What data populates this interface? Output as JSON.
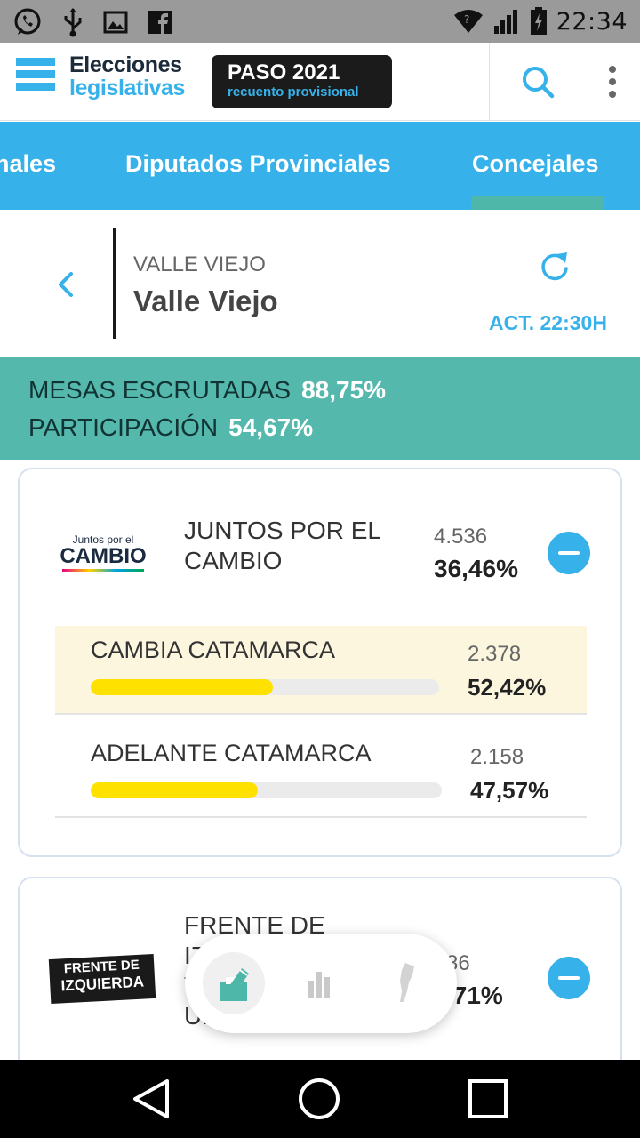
{
  "status_bar": {
    "time": "22:34",
    "icons_left": [
      "whatsapp-icon",
      "usb-icon",
      "image-icon",
      "facebook-icon"
    ],
    "icons_right": [
      "wifi-icon",
      "signal-icon",
      "battery-icon"
    ]
  },
  "header": {
    "logo_line1": "Elecciones",
    "logo_line2": "legislativas",
    "badge_title": "PASO 2021",
    "badge_subtitle": "recuento provisional",
    "colors": {
      "accent": "#36b1e9",
      "dark": "#1b1b1b"
    }
  },
  "tabs": [
    {
      "label": "nales",
      "active": false
    },
    {
      "label": "Diputados Provinciales",
      "active": false
    },
    {
      "label": "Concejales",
      "active": true
    }
  ],
  "location": {
    "district_upper": "VALLE VIEJO",
    "district_name": "Valle Viejo",
    "updated": "ACT. 22:30H"
  },
  "stats": {
    "mesas_label": "MESAS ESCRUTADAS",
    "mesas_value": "88,75%",
    "participacion_label": "PARTICIPACIÓN",
    "participacion_value": "54,67%",
    "band_color": "#55b8ad"
  },
  "parties": [
    {
      "logo_line1": "Juntos por el",
      "logo_line2": "CAMBIO",
      "name_line1": "JUNTOS POR EL",
      "name_line2": "CAMBIO",
      "votes": "4.536",
      "percent": "36,46%",
      "lists": [
        {
          "name": "CAMBIA CATAMARCA",
          "votes": "2.378",
          "percent": "52,42%",
          "share": 0.5242,
          "highlighted": true
        },
        {
          "name": "ADELANTE CATAMARCA",
          "votes": "2.158",
          "percent": "47,57%",
          "share": 0.4757,
          "highlighted": false
        }
      ]
    },
    {
      "logo_line1": "FRENTE DE",
      "logo_line2": "IZQUIERDA",
      "name_line1": "FRENTE DE",
      "name_line2": "IZ",
      "name_line3": "T",
      "name_line4": "UI",
      "votes": "86",
      "percent": ",71%"
    }
  ],
  "floating_nav": [
    "vote-box-icon",
    "bar-chart-icon",
    "argentina-map-icon"
  ],
  "nav_bar": [
    "back-icon",
    "home-icon",
    "recents-icon"
  ]
}
